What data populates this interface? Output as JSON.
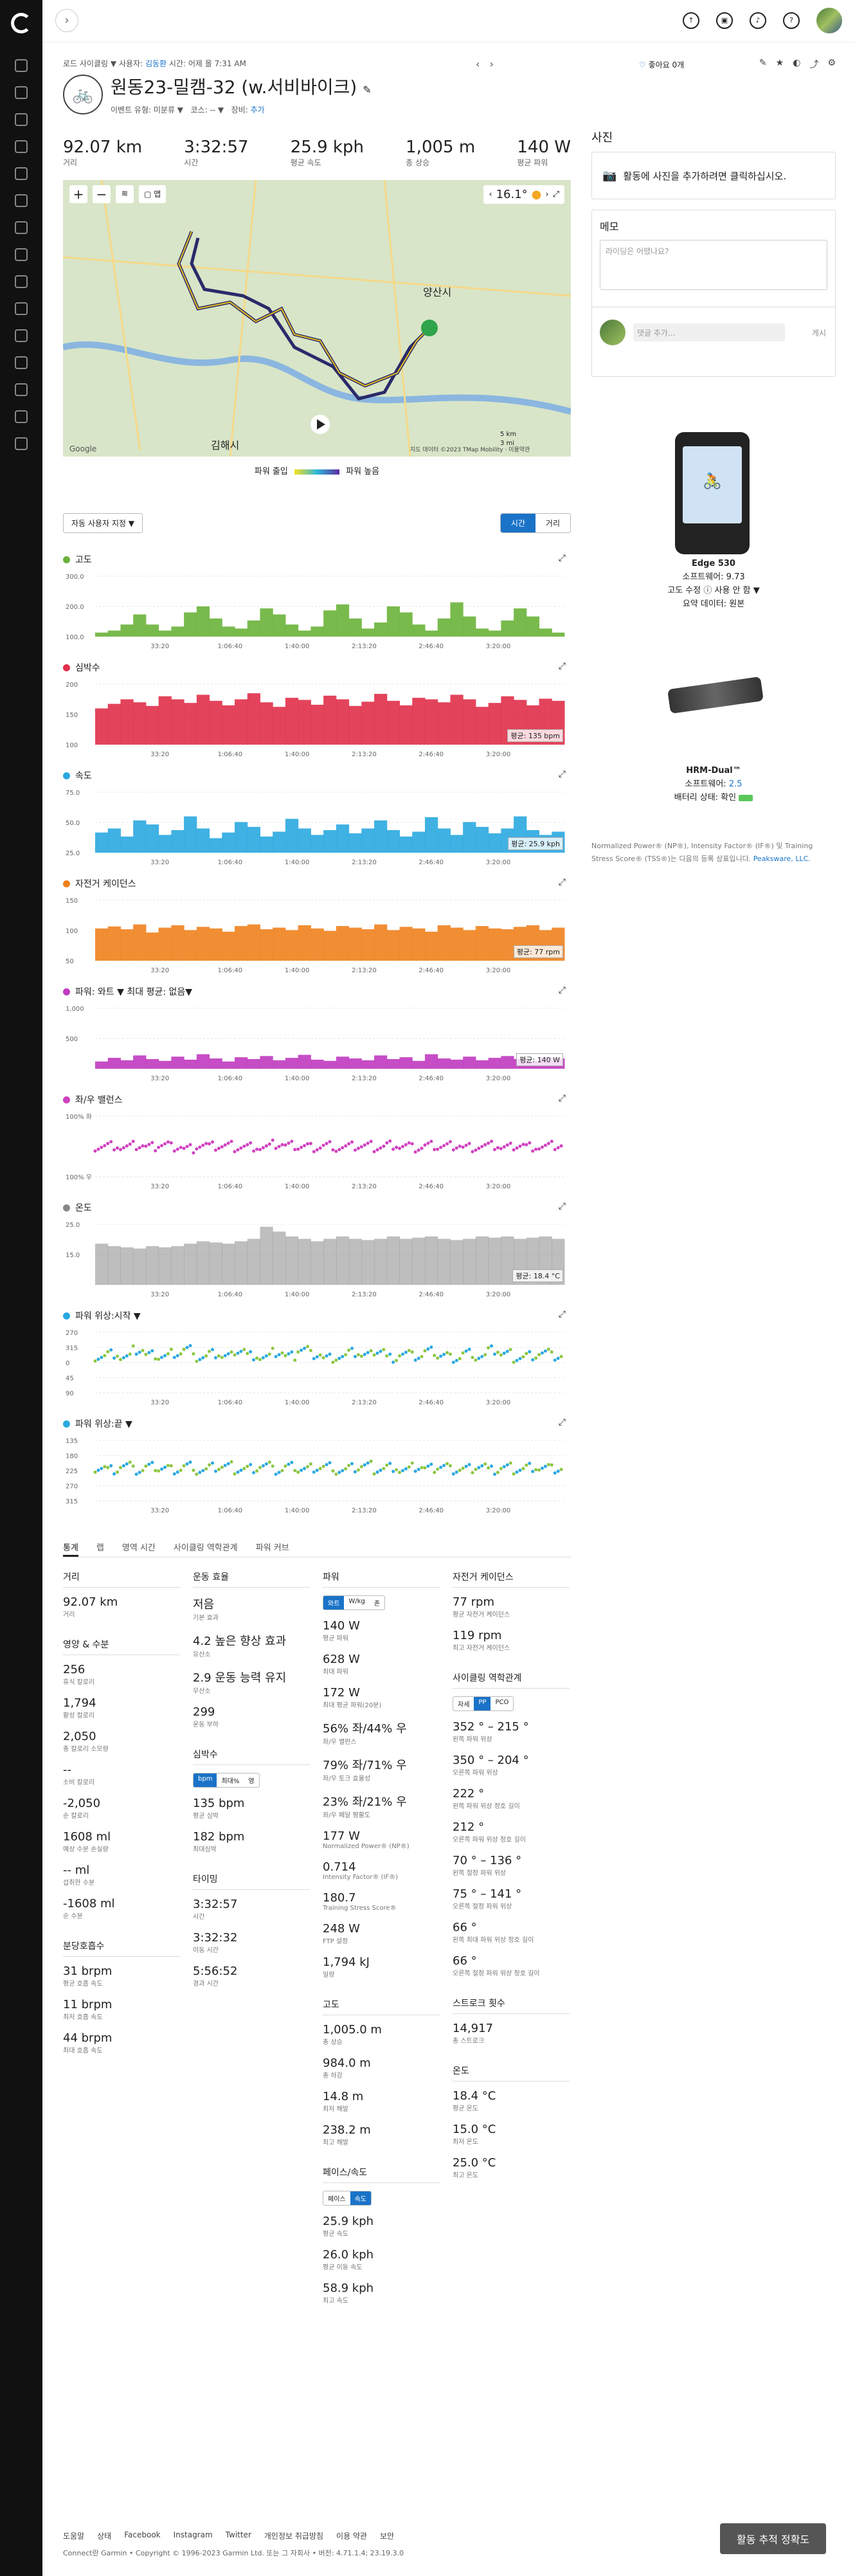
{
  "topbar": {
    "collapse_glyph": "›"
  },
  "header": {
    "breadcrumb": [
      "로드 사이클링",
      "▼",
      "사용자:",
      "김동환",
      "시간: 어제 올 7:31 AM"
    ],
    "title": "원동23-밀캠-32 (w.서비바이크)",
    "meta": [
      "이벤트 유형: 미분류 ▼",
      "코스: -- ▼",
      "장비:",
      "추가"
    ],
    "likes": "좋아요 0개"
  },
  "stats": [
    {
      "value": "92.07 km",
      "label": "거리"
    },
    {
      "value": "3:32:57",
      "label": "시간"
    },
    {
      "value": "25.9 kph",
      "label": "평균 속도"
    },
    {
      "value": "1,005 m",
      "label": "총 상승"
    },
    {
      "value": "140 W",
      "label": "평균 파워"
    }
  ],
  "map": {
    "temp": "16.1°",
    "labels": [
      "양산시",
      "김해시"
    ],
    "scale": [
      "5 km",
      "3 mi"
    ],
    "copyright": "지도 데이터 ©2023 TMap Mobility · 이용약관",
    "google": "Google"
  },
  "map_legend": {
    "low": "파워 출입",
    "high": "파워 높음"
  },
  "chart_controls": {
    "select": "자동 사용자 지정 ▼",
    "toggle": [
      "시간",
      "거리"
    ]
  },
  "charts": [
    {
      "title": "고도",
      "color": "#6ab23a",
      "yticks": [
        "300.0",
        "200.0",
        "100.0"
      ],
      "avg": "",
      "values": [
        20,
        30,
        60,
        110,
        60,
        30,
        50,
        120,
        150,
        90,
        50,
        40,
        80,
        140,
        110,
        60,
        30,
        50,
        130,
        160,
        90,
        40,
        70,
        150,
        120,
        60,
        30,
        90,
        170,
        100,
        40,
        30,
        80,
        140,
        100,
        40,
        20
      ],
      "ymax": 300
    },
    {
      "title": "심박수",
      "color": "#e0304a",
      "yticks": [
        "200",
        "150",
        "100"
      ],
      "avg": "평균: 135 bpm",
      "values": [
        120,
        135,
        150,
        140,
        128,
        160,
        150,
        138,
        165,
        145,
        130,
        150,
        170,
        140,
        125,
        155,
        148,
        132,
        162,
        150,
        128,
        142,
        168,
        145,
        130,
        155,
        150,
        140,
        165,
        150,
        125,
        138,
        160,
        148,
        130,
        152,
        145
      ],
      "ymax": 200
    },
    {
      "title": "속도",
      "color": "#2aa8e0",
      "yticks": [
        "75.0",
        "50.0",
        "25.0"
      ],
      "avg": "평균: 25.9 kph",
      "values": [
        25,
        30,
        20,
        40,
        35,
        22,
        28,
        45,
        30,
        18,
        25,
        38,
        32,
        20,
        26,
        42,
        30,
        22,
        28,
        35,
        24,
        30,
        40,
        28,
        20,
        26,
        44,
        30,
        22,
        38,
        32,
        24,
        30,
        45,
        28,
        22,
        26
      ],
      "ymax": 75
    },
    {
      "title": "자전거 케이던스",
      "color": "#f0821e",
      "yticks": [
        "150",
        "100",
        "50"
      ],
      "avg": "평균: 77 rpm",
      "values": [
        80,
        85,
        78,
        90,
        70,
        82,
        88,
        76,
        84,
        80,
        72,
        86,
        90,
        78,
        82,
        76,
        88,
        80,
        74,
        86,
        82,
        78,
        90,
        76,
        84,
        80,
        72,
        88,
        82,
        76,
        86,
        80,
        78,
        84,
        88,
        76,
        82
      ],
      "ymax": 150
    },
    {
      "title": "파워: 와트 ▼   최대 평균: 없음▼",
      "color": "#c03ac0",
      "yticks": [
        "1,000",
        "500",
        ""
      ],
      "avg": "평균: 140 W",
      "values": [
        120,
        180,
        140,
        220,
        160,
        130,
        200,
        150,
        240,
        170,
        120,
        190,
        160,
        210,
        140,
        180,
        230,
        150,
        130,
        200,
        170,
        140,
        220,
        160,
        190,
        130,
        240,
        170,
        150,
        200,
        140,
        180,
        210,
        160,
        130,
        190,
        170
      ],
      "ymax": 1000
    },
    {
      "title": "좌/우 밸런스",
      "color": "#d040c0",
      "yticks": [
        "100% 좌",
        "",
        "100% 우"
      ],
      "avg": "",
      "values": [
        50,
        52,
        48,
        51,
        49,
        53,
        50,
        47,
        52,
        50,
        51,
        49,
        50,
        48,
        53,
        51,
        50,
        49,
        52,
        48,
        50,
        51,
        49,
        53,
        50,
        47,
        51,
        50,
        52,
        49,
        50,
        51,
        48,
        52,
        50,
        49,
        51
      ],
      "ymax": 100
    },
    {
      "title": "온도",
      "color": "#888",
      "yticks": [
        "25.0",
        "15.0",
        ""
      ],
      "avg": "평균: 18.4 °C",
      "values": [
        17,
        16,
        15.5,
        15,
        16,
        15.5,
        16,
        17,
        18,
        17.5,
        17,
        18,
        19,
        24,
        22,
        20,
        19,
        18,
        19,
        20,
        19,
        18.5,
        19,
        20,
        19,
        19.5,
        20,
        19,
        18.5,
        19,
        20,
        19.5,
        20,
        19,
        19.5,
        20,
        19
      ],
      "ymax": 25
    },
    {
      "title": "파워 위상:시작 ▼",
      "color": "#2aa8e0",
      "yticks": [
        "270",
        "315",
        "0",
        "45",
        "90"
      ],
      "avg": "",
      "values": [
        60,
        65,
        58,
        70,
        62,
        60,
        66,
        72,
        58,
        64,
        60,
        70,
        62,
        58,
        66,
        60,
        72,
        64,
        58,
        60,
        66,
        62,
        70,
        58,
        64,
        60,
        68,
        62,
        58,
        66,
        60,
        70,
        64,
        58,
        62,
        66,
        60
      ],
      "ymax": 100
    },
    {
      "title": "파워 위상:끝 ▼",
      "color": "#2aa8e0",
      "yticks": [
        "135",
        "180",
        "225",
        "270",
        "315"
      ],
      "avg": "",
      "values": [
        55,
        52,
        58,
        50,
        56,
        54,
        52,
        58,
        50,
        55,
        57,
        52,
        54,
        58,
        50,
        56,
        52,
        55,
        57,
        50,
        54,
        58,
        52,
        56,
        50,
        55,
        53,
        57,
        52,
        54,
        58,
        50,
        55,
        52,
        56,
        54,
        52
      ],
      "ymax": 100
    }
  ],
  "x_ticks": [
    "33:20",
    "1:06:40",
    "1:40:00",
    "2:13:20",
    "2:46:40",
    "3:20:00"
  ],
  "tabs": [
    "통계",
    "랩",
    "영역 시간",
    "사이클링 역학관계",
    "파워 커브"
  ],
  "col1": {
    "distance_title": "거리",
    "distance": {
      "v": "92.07 km",
      "l": "거리"
    },
    "cal_title": "영양 & 수분",
    "calories": [
      {
        "v": "256",
        "l": "휴식 칼로리"
      },
      {
        "v": "1,794",
        "l": "활성 칼로리"
      },
      {
        "v": "2,050",
        "l": "총 칼로리 소모량"
      },
      {
        "v": "--",
        "l": "소비 칼로리"
      },
      {
        "v": "-2,050",
        "l": "순 칼로리"
      },
      {
        "v": "1608 ml",
        "l": "예상 수분 손실량"
      },
      {
        "v": "-- ml",
        "l": "섭취한 수분"
      },
      {
        "v": "-1608 ml",
        "l": "순 수분"
      }
    ],
    "resp_title": "분당호흡수",
    "resp": [
      {
        "v": "31 brpm",
        "l": "평균 호흡 속도"
      },
      {
        "v": "11 brpm",
        "l": "최저 호흡 속도"
      },
      {
        "v": "44 brpm",
        "l": "최대 호흡 속도"
      }
    ]
  },
  "col2": {
    "te_title": "운동 효율",
    "te": [
      {
        "v": "저음",
        "l": "기본 효과"
      },
      {
        "v": "4.2 높은 향상 효과",
        "l": "유산소"
      },
      {
        "v": "2.9 운동 능력 유지",
        "l": "무산소"
      },
      {
        "v": "299",
        "l": "운동 부하"
      }
    ],
    "hr_title": "심박수",
    "hr_seg": [
      "bpm",
      "최대%",
      "영"
    ],
    "hr": [
      {
        "v": "135 bpm",
        "l": "평균 심박"
      },
      {
        "v": "182 bpm",
        "l": "최대심박"
      }
    ],
    "timing_title": "타이밍",
    "timing": [
      {
        "v": "3:32:57",
        "l": "시간"
      },
      {
        "v": "3:32:32",
        "l": "이동 시간"
      },
      {
        "v": "5:56:52",
        "l": "경과 시간"
      }
    ]
  },
  "col3": {
    "power_title": "파워",
    "power_seg": [
      "와트",
      "W/kg",
      "존"
    ],
    "power": [
      {
        "v": "140 W",
        "l": "평균 파워"
      },
      {
        "v": "628 W",
        "l": "최대 파워"
      },
      {
        "v": "172 W",
        "l": "최대 평균 파워(20분)"
      },
      {
        "v": "56% 좌/44% 우",
        "l": "좌/우 밸런스"
      },
      {
        "v": "79% 좌/71% 우",
        "l": "좌/우 토크 효율성"
      },
      {
        "v": "23% 좌/21% 우",
        "l": "좌/우 페달 평활도"
      },
      {
        "v": "177 W",
        "l": "Normalized Power® (NP®)"
      },
      {
        "v": "0.714",
        "l": "Intensity Factor® (IF®)"
      },
      {
        "v": "180.7",
        "l": "Training Stress Score®"
      },
      {
        "v": "248 W",
        "l": "FTP 설정"
      },
      {
        "v": "1,794 kJ",
        "l": "일량"
      }
    ],
    "elev_title": "고도",
    "elev": [
      {
        "v": "1,005.0 m",
        "l": "총 상승"
      },
      {
        "v": "984.0 m",
        "l": "총 하강"
      },
      {
        "v": "14.8 m",
        "l": "최저 해발"
      },
      {
        "v": "238.2 m",
        "l": "최고 해발"
      }
    ],
    "pace_title": "페이스/속도",
    "pace_seg": [
      "페이스",
      "속도"
    ],
    "pace": [
      {
        "v": "25.9 kph",
        "l": "평균 속도"
      },
      {
        "v": "26.0 kph",
        "l": "평균 이동 속도"
      },
      {
        "v": "58.9 kph",
        "l": "최고 속도"
      }
    ]
  },
  "col4": {
    "cad_title": "자전거 케이던스",
    "cad": [
      {
        "v": "77 rpm",
        "l": "평균 자전거 케이던스"
      },
      {
        "v": "119 rpm",
        "l": "최고 자전거 케이던스"
      }
    ],
    "dyn_title": "사이클링 역학관계",
    "dyn_seg": [
      "자세",
      "PP",
      "PCO"
    ],
    "dyn": [
      {
        "v": "352 ° – 215 °",
        "l": "왼쪽 파워 위상"
      },
      {
        "v": "350 ° – 204 °",
        "l": "오른쪽 파워 위상"
      },
      {
        "v": "222 °",
        "l": "왼쪽 파워 위상 정호 길이"
      },
      {
        "v": "212 °",
        "l": "오른쪽 파워 위상 정호 길이"
      },
      {
        "v": "70 ° – 136 °",
        "l": "왼쪽 절정 파워 위상"
      },
      {
        "v": "75 ° – 141 °",
        "l": "오른쪽 절정 파워 위상"
      },
      {
        "v": "66 °",
        "l": "왼쪽 최대 파워 위상 정호 길이"
      },
      {
        "v": "66 °",
        "l": "오른쪽 절정 파워 위상 정호 길이"
      }
    ],
    "stroke_title": "스트로크 횟수",
    "stroke": [
      {
        "v": "14,917",
        "l": "총 스트로크"
      }
    ],
    "temp_title": "온도",
    "temp": [
      {
        "v": "18.4 °C",
        "l": "평균 온도"
      },
      {
        "v": "15.0 °C",
        "l": "최저 온도"
      },
      {
        "v": "25.0 °C",
        "l": "최고 온도"
      }
    ]
  },
  "right": {
    "photo_title": "사진",
    "photo_prompt": "활동에 사진을 추가하려면 클릭하십시오.",
    "memo_title": "메모",
    "memo_placeholder": "라이딩은 어땠나요?",
    "comment_placeholder": "댓글 추가...",
    "post": "게시",
    "device1": {
      "name": "Edge 530",
      "sw": "소프트웨어: 9.73",
      "alt": "고도 수정 ⓘ 사용 안 함 ▼",
      "summary": "요약 데이터: 원본"
    },
    "device2": {
      "name": "HRM-Dual™",
      "sw_label": "소프트웨어:",
      "sw": "2.5",
      "battery": "배터리 상태: 확인"
    },
    "legal": "Normalized Power® (NP®), Intensity Factor® (IF®) 및 Training Stress Score® (TSS®)는 다음의 등록 상표입니다.",
    "legal_link": "Peaksware, LLC."
  },
  "footer": {
    "links": [
      "도움말",
      "상태",
      "Facebook",
      "Instagram",
      "Twitter",
      "개인정보 취급방침",
      "이용 약관",
      "보안"
    ],
    "copy": "Connect란 Garmin • Copyright © 1996-2023 Garmin Ltd. 또는 그 자회사 • 버전: 4.71.1.4; 23.19.3.0"
  },
  "accuracy_button": "활동 추적 정확도"
}
